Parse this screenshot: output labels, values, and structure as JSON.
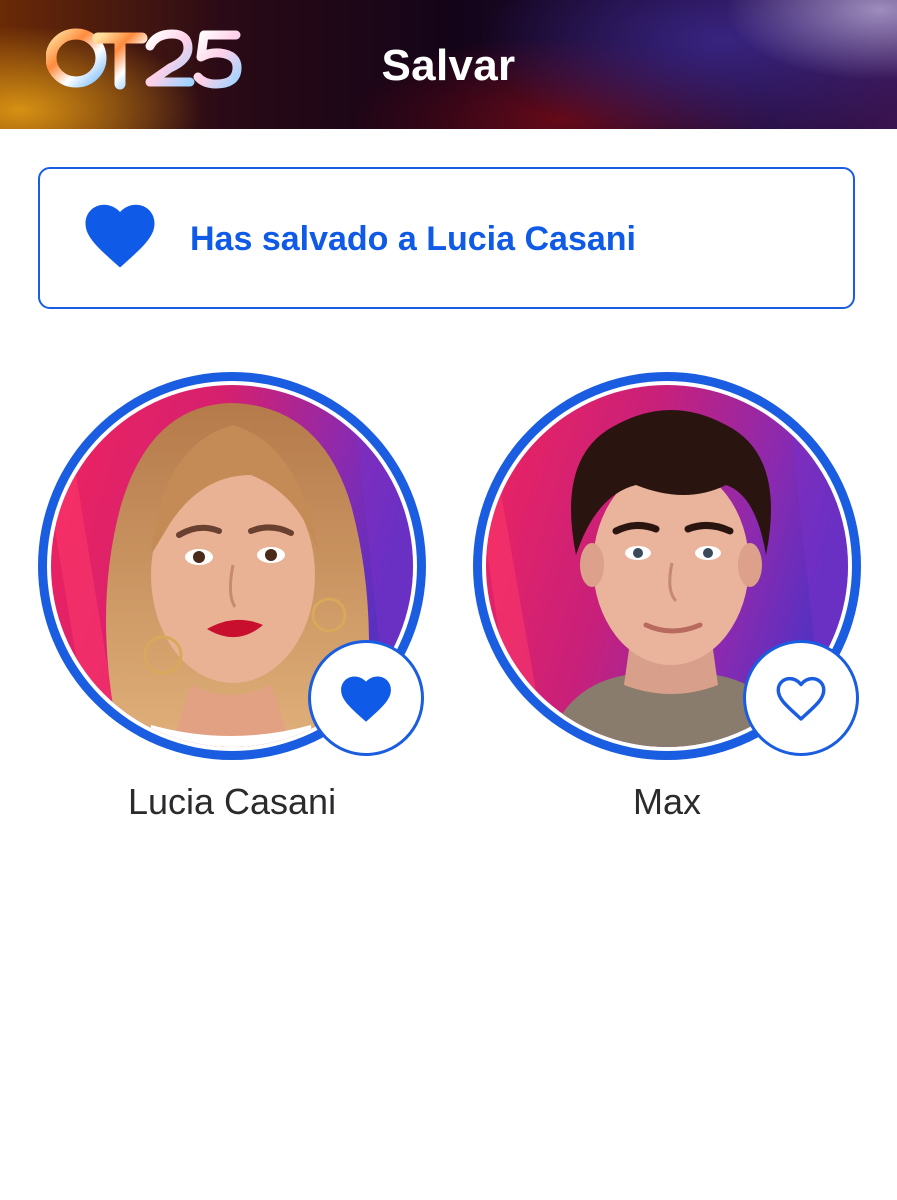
{
  "header": {
    "logo_text": "OT25",
    "title": "Salvar"
  },
  "confirmation": {
    "icon": "heart-filled-icon",
    "text": "Has salvado a Lucia Casani"
  },
  "candidates": [
    {
      "name": "Lucia Casani",
      "saved": true,
      "vote_icon": "heart-filled-icon"
    },
    {
      "name": "Max",
      "saved": false,
      "vote_icon": "heart-outline-icon"
    }
  ],
  "colors": {
    "accent": "#1a5de0",
    "accent_text": "#0f5ae6",
    "name_text": "#2b2b2e",
    "background": "#ffffff"
  }
}
